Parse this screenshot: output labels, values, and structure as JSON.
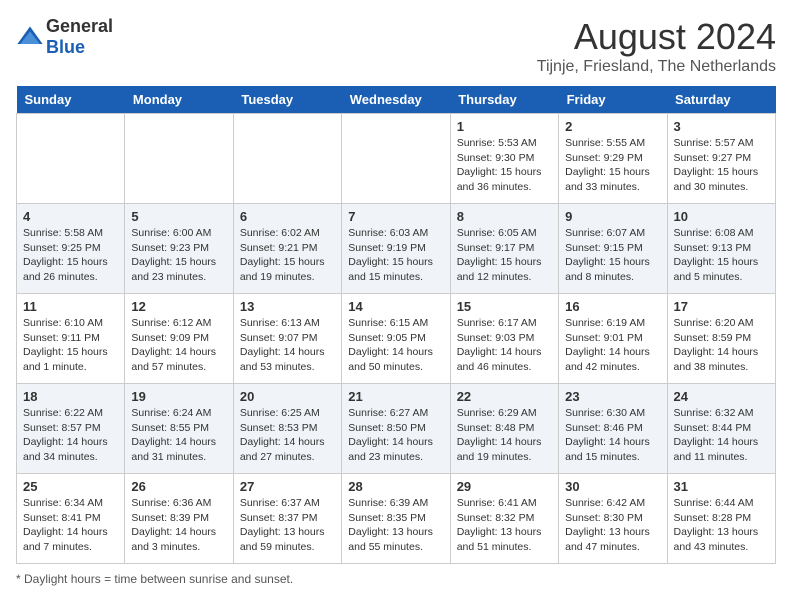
{
  "header": {
    "logo_general": "General",
    "logo_blue": "Blue",
    "title": "August 2024",
    "subtitle": "Tijnje, Friesland, The Netherlands"
  },
  "days_of_week": [
    "Sunday",
    "Monday",
    "Tuesday",
    "Wednesday",
    "Thursday",
    "Friday",
    "Saturday"
  ],
  "footer": {
    "note": "Daylight hours"
  },
  "weeks": [
    [
      {
        "day": "",
        "content": ""
      },
      {
        "day": "",
        "content": ""
      },
      {
        "day": "",
        "content": ""
      },
      {
        "day": "",
        "content": ""
      },
      {
        "day": "1",
        "content": "Sunrise: 5:53 AM\nSunset: 9:30 PM\nDaylight: 15 hours\nand 36 minutes."
      },
      {
        "day": "2",
        "content": "Sunrise: 5:55 AM\nSunset: 9:29 PM\nDaylight: 15 hours\nand 33 minutes."
      },
      {
        "day": "3",
        "content": "Sunrise: 5:57 AM\nSunset: 9:27 PM\nDaylight: 15 hours\nand 30 minutes."
      }
    ],
    [
      {
        "day": "4",
        "content": "Sunrise: 5:58 AM\nSunset: 9:25 PM\nDaylight: 15 hours\nand 26 minutes."
      },
      {
        "day": "5",
        "content": "Sunrise: 6:00 AM\nSunset: 9:23 PM\nDaylight: 15 hours\nand 23 minutes."
      },
      {
        "day": "6",
        "content": "Sunrise: 6:02 AM\nSunset: 9:21 PM\nDaylight: 15 hours\nand 19 minutes."
      },
      {
        "day": "7",
        "content": "Sunrise: 6:03 AM\nSunset: 9:19 PM\nDaylight: 15 hours\nand 15 minutes."
      },
      {
        "day": "8",
        "content": "Sunrise: 6:05 AM\nSunset: 9:17 PM\nDaylight: 15 hours\nand 12 minutes."
      },
      {
        "day": "9",
        "content": "Sunrise: 6:07 AM\nSunset: 9:15 PM\nDaylight: 15 hours\nand 8 minutes."
      },
      {
        "day": "10",
        "content": "Sunrise: 6:08 AM\nSunset: 9:13 PM\nDaylight: 15 hours\nand 5 minutes."
      }
    ],
    [
      {
        "day": "11",
        "content": "Sunrise: 6:10 AM\nSunset: 9:11 PM\nDaylight: 15 hours\nand 1 minute."
      },
      {
        "day": "12",
        "content": "Sunrise: 6:12 AM\nSunset: 9:09 PM\nDaylight: 14 hours\nand 57 minutes."
      },
      {
        "day": "13",
        "content": "Sunrise: 6:13 AM\nSunset: 9:07 PM\nDaylight: 14 hours\nand 53 minutes."
      },
      {
        "day": "14",
        "content": "Sunrise: 6:15 AM\nSunset: 9:05 PM\nDaylight: 14 hours\nand 50 minutes."
      },
      {
        "day": "15",
        "content": "Sunrise: 6:17 AM\nSunset: 9:03 PM\nDaylight: 14 hours\nand 46 minutes."
      },
      {
        "day": "16",
        "content": "Sunrise: 6:19 AM\nSunset: 9:01 PM\nDaylight: 14 hours\nand 42 minutes."
      },
      {
        "day": "17",
        "content": "Sunrise: 6:20 AM\nSunset: 8:59 PM\nDaylight: 14 hours\nand 38 minutes."
      }
    ],
    [
      {
        "day": "18",
        "content": "Sunrise: 6:22 AM\nSunset: 8:57 PM\nDaylight: 14 hours\nand 34 minutes."
      },
      {
        "day": "19",
        "content": "Sunrise: 6:24 AM\nSunset: 8:55 PM\nDaylight: 14 hours\nand 31 minutes."
      },
      {
        "day": "20",
        "content": "Sunrise: 6:25 AM\nSunset: 8:53 PM\nDaylight: 14 hours\nand 27 minutes."
      },
      {
        "day": "21",
        "content": "Sunrise: 6:27 AM\nSunset: 8:50 PM\nDaylight: 14 hours\nand 23 minutes."
      },
      {
        "day": "22",
        "content": "Sunrise: 6:29 AM\nSunset: 8:48 PM\nDaylight: 14 hours\nand 19 minutes."
      },
      {
        "day": "23",
        "content": "Sunrise: 6:30 AM\nSunset: 8:46 PM\nDaylight: 14 hours\nand 15 minutes."
      },
      {
        "day": "24",
        "content": "Sunrise: 6:32 AM\nSunset: 8:44 PM\nDaylight: 14 hours\nand 11 minutes."
      }
    ],
    [
      {
        "day": "25",
        "content": "Sunrise: 6:34 AM\nSunset: 8:41 PM\nDaylight: 14 hours\nand 7 minutes."
      },
      {
        "day": "26",
        "content": "Sunrise: 6:36 AM\nSunset: 8:39 PM\nDaylight: 14 hours\nand 3 minutes."
      },
      {
        "day": "27",
        "content": "Sunrise: 6:37 AM\nSunset: 8:37 PM\nDaylight: 13 hours\nand 59 minutes."
      },
      {
        "day": "28",
        "content": "Sunrise: 6:39 AM\nSunset: 8:35 PM\nDaylight: 13 hours\nand 55 minutes."
      },
      {
        "day": "29",
        "content": "Sunrise: 6:41 AM\nSunset: 8:32 PM\nDaylight: 13 hours\nand 51 minutes."
      },
      {
        "day": "30",
        "content": "Sunrise: 6:42 AM\nSunset: 8:30 PM\nDaylight: 13 hours\nand 47 minutes."
      },
      {
        "day": "31",
        "content": "Sunrise: 6:44 AM\nSunset: 8:28 PM\nDaylight: 13 hours\nand 43 minutes."
      }
    ]
  ]
}
